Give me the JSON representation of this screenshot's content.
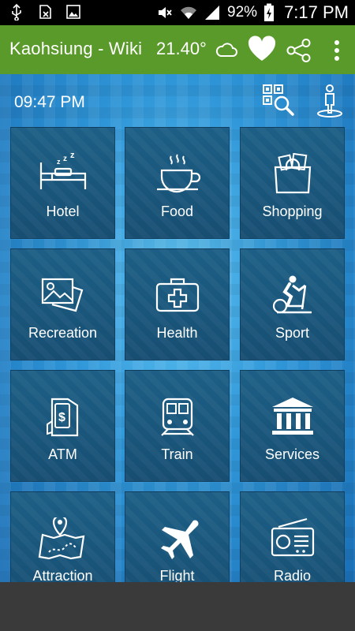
{
  "status_bar": {
    "battery_percent": "92%",
    "time": "7:17 PM",
    "icons": [
      "usb-icon",
      "no-sim-icon",
      "gallery-icon",
      "mute-icon",
      "wifi-icon",
      "signal-icon",
      "battery-charging-icon"
    ]
  },
  "app_bar": {
    "title": "Kaohsiung - Wiki",
    "temperature": "21.40°",
    "icons": [
      "cloud-icon",
      "favorite-heart-icon",
      "share-icon",
      "overflow-menu-icon"
    ]
  },
  "main": {
    "clock": "09:47 PM",
    "top_icons": [
      "qr-search-icon",
      "person-location-icon"
    ],
    "tiles": [
      {
        "label": "Hotel",
        "icon": "bed-icon"
      },
      {
        "label": "Food",
        "icon": "coffee-cup-icon"
      },
      {
        "label": "Shopping",
        "icon": "shopping-bag-icon"
      },
      {
        "label": "Recreation",
        "icon": "photos-icon"
      },
      {
        "label": "Health",
        "icon": "first-aid-kit-icon"
      },
      {
        "label": "Sport",
        "icon": "exercise-bike-icon"
      },
      {
        "label": "ATM",
        "icon": "atm-machine-icon"
      },
      {
        "label": "Train",
        "icon": "train-icon"
      },
      {
        "label": "Services",
        "icon": "government-building-icon"
      },
      {
        "label": "Attraction",
        "icon": "map-pin-icon"
      },
      {
        "label": "Flight",
        "icon": "airplane-icon"
      },
      {
        "label": "Radio",
        "icon": "radio-icon"
      }
    ]
  },
  "colors": {
    "app_bar": "#5a9a2a",
    "tile": "#1d5f86",
    "background_blue": "#2f96d8"
  }
}
